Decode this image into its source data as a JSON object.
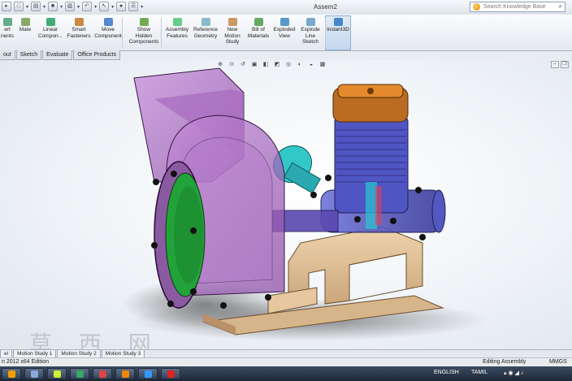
{
  "app": {
    "document_title": "Assem2",
    "search_placeholder": "Search Knowledge Base"
  },
  "ribbon": {
    "buttons": [
      {
        "label": "ert\nnents",
        "icon": "insert-components-icon"
      },
      {
        "label": "Mate",
        "icon": "mate-icon"
      },
      {
        "label": "Linear\nCompon...",
        "icon": "linear-pattern-icon"
      },
      {
        "label": "Smart\nFasteners",
        "icon": "smart-fasteners-icon"
      },
      {
        "label": "Move\nComponent",
        "icon": "move-component-icon"
      },
      {
        "label": "Show\nHidden\nComponents",
        "icon": "show-hidden-icon"
      },
      {
        "label": "Assembly\nFeatures",
        "icon": "assembly-features-icon"
      },
      {
        "label": "Reference\nGeometry",
        "icon": "reference-geometry-icon"
      },
      {
        "label": "New\nMotion\nStudy",
        "icon": "motion-study-icon"
      },
      {
        "label": "Bill of\nMaterials",
        "icon": "bill-of-materials-icon"
      },
      {
        "label": "Exploded\nView",
        "icon": "exploded-view-icon"
      },
      {
        "label": "Explode\nLine\nSketch",
        "icon": "explode-line-sketch-icon"
      },
      {
        "label": "Instant3D",
        "icon": "instant3d-icon"
      }
    ]
  },
  "command_tabs": [
    "out",
    "Sketch",
    "Evaluate",
    "Office Products"
  ],
  "motion_tabs": [
    "el",
    "Motion Study 1",
    "Motion Study 2",
    "Motion Study 3"
  ],
  "status": {
    "left": "n 2012 x64 Edition",
    "mode": "Editing Assembly",
    "units": "MMGS"
  },
  "taskbar": {
    "language": "ENGLISH",
    "keyboard": "TAMIL"
  },
  "watermark": "草 西 网",
  "colors": {
    "accent": "#c6d8ee",
    "housing": "#b277c8",
    "frame": "#e3c39a",
    "engine": "#4b4fb8",
    "filter": "#3cc1c8",
    "inlet": "#22a33a"
  }
}
